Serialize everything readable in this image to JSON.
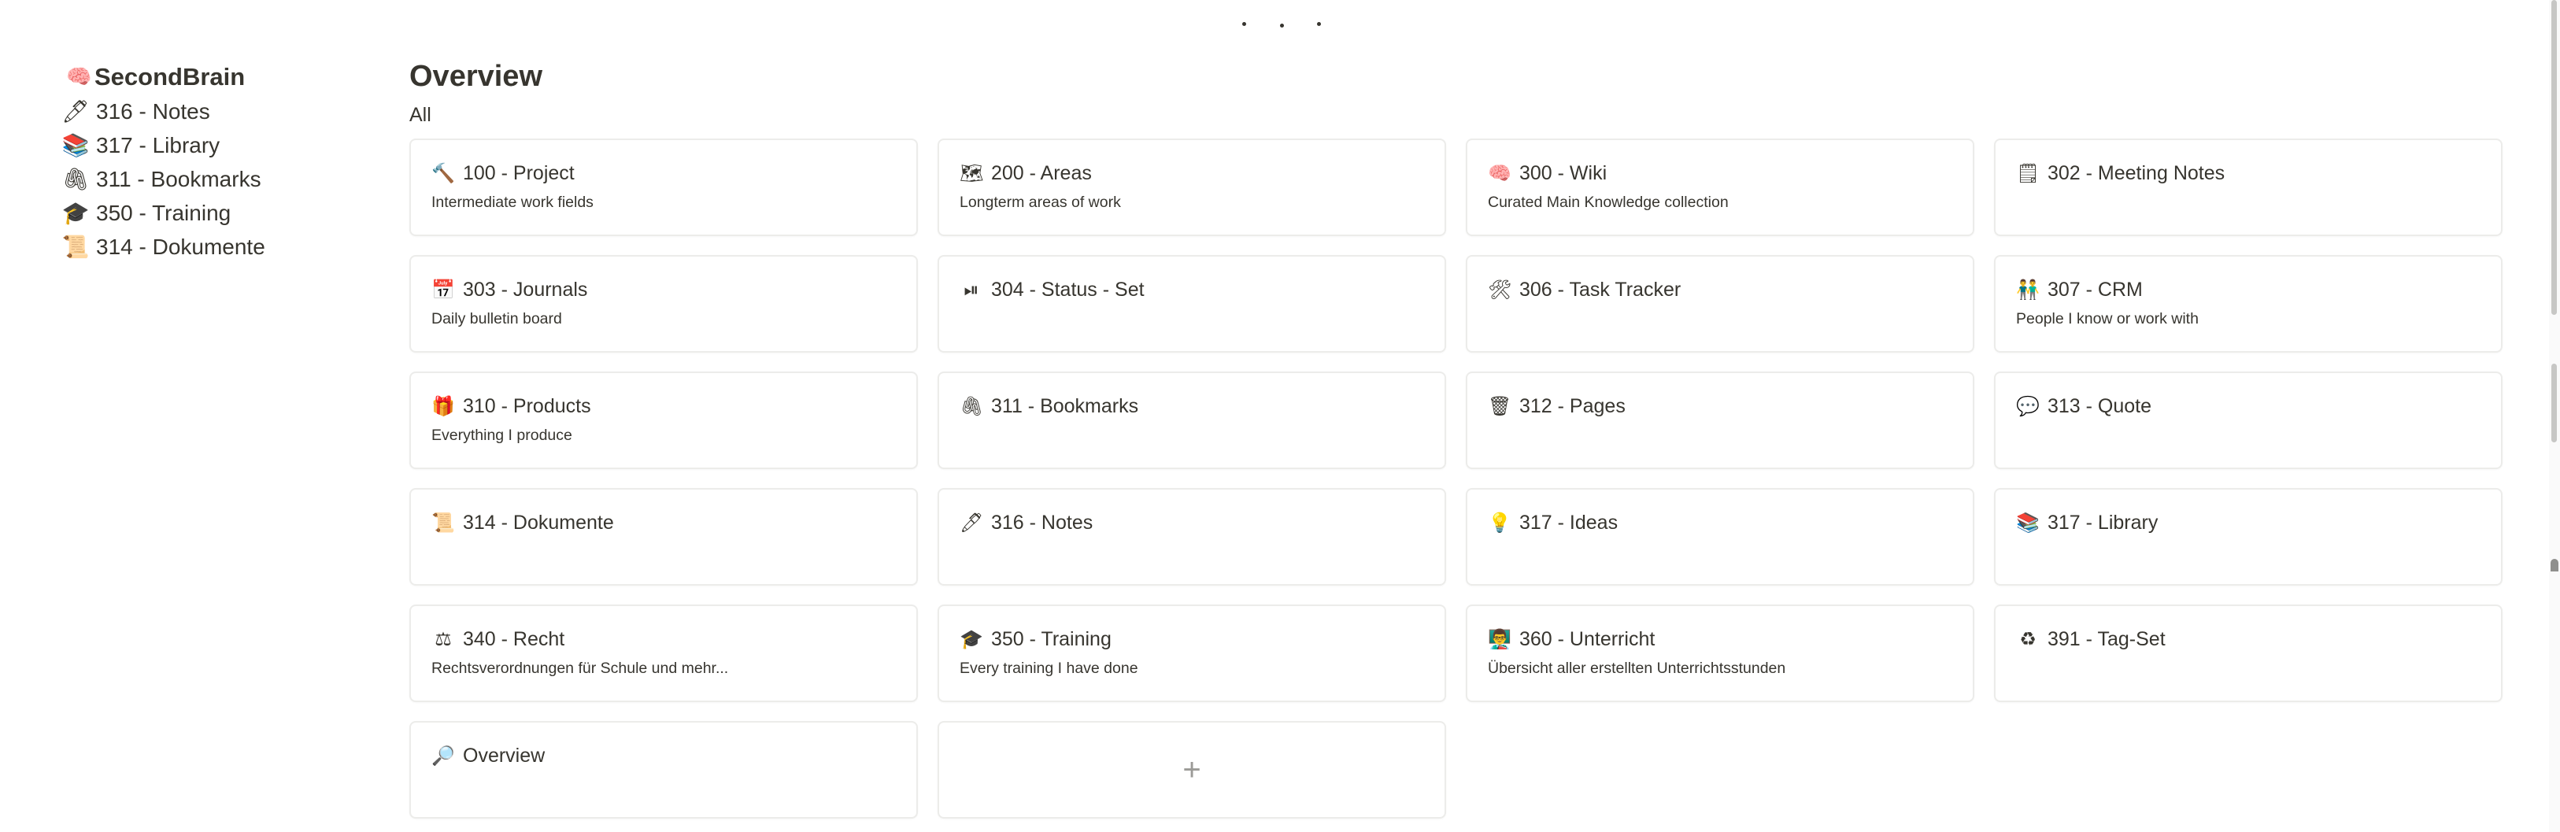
{
  "sidebar": {
    "title": "SecondBrain",
    "title_icon": "brain-icon",
    "title_glyph": "🧠",
    "items": [
      {
        "label": "316 - Notes",
        "icon": "pen-icon",
        "glyph": "🖊"
      },
      {
        "label": "317 - Library",
        "icon": "books-icon",
        "glyph": "📚"
      },
      {
        "label": "311 - Bookmarks",
        "icon": "paperclip-icon",
        "glyph": "🖇"
      },
      {
        "label": "350 - Training",
        "icon": "graduation-cap-icon",
        "glyph": "🎓"
      },
      {
        "label": "314 - Dokumente",
        "icon": "scroll-icon",
        "glyph": "📜"
      }
    ]
  },
  "main": {
    "title": "Overview",
    "filter": "All",
    "add_label": "+",
    "cards": [
      {
        "title": "100 - Project",
        "subtitle": "Intermediate work fields",
        "icon": "hammer-icon",
        "glyph": "🔨"
      },
      {
        "title": "200 - Areas",
        "subtitle": "Longterm areas of work",
        "icon": "map-icon",
        "glyph": "🗺"
      },
      {
        "title": "300 - Wiki",
        "subtitle": "Curated Main Knowledge collection",
        "icon": "brain-icon",
        "glyph": "🧠"
      },
      {
        "title": "302 - Meeting Notes",
        "subtitle": "",
        "icon": "notepad-icon",
        "glyph": "🗒"
      },
      {
        "title": "303 - Journals",
        "subtitle": "Daily bulletin board",
        "icon": "calendar-icon",
        "glyph": "📅"
      },
      {
        "title": "304 - Status - Set",
        "subtitle": "",
        "icon": "play-pause-icon",
        "glyph": "⏯"
      },
      {
        "title": "306 - Task Tracker",
        "subtitle": "",
        "icon": "tools-icon",
        "glyph": "🛠"
      },
      {
        "title": "307 - CRM",
        "subtitle": "People I know or work with",
        "icon": "people-icon",
        "glyph": "👬"
      },
      {
        "title": "310 - Products",
        "subtitle": "Everything I produce",
        "icon": "products-icon",
        "glyph": "🎁"
      },
      {
        "title": "311 - Bookmarks",
        "subtitle": "",
        "icon": "paperclip-icon",
        "glyph": "🖇"
      },
      {
        "title": "312 - Pages",
        "subtitle": "",
        "icon": "wastebasket-icon",
        "glyph": "🗑"
      },
      {
        "title": "313 - Quote",
        "subtitle": "",
        "icon": "speech-bubble-icon",
        "glyph": "💬"
      },
      {
        "title": "314 - Dokumente",
        "subtitle": "",
        "icon": "scroll-icon",
        "glyph": "📜"
      },
      {
        "title": "316 - Notes",
        "subtitle": "",
        "icon": "pen-icon",
        "glyph": "🖊"
      },
      {
        "title": "317 - Ideas",
        "subtitle": "",
        "icon": "lightbulb-icon",
        "glyph": "💡"
      },
      {
        "title": "317 - Library",
        "subtitle": "",
        "icon": "books-icon",
        "glyph": "📚"
      },
      {
        "title": "340 - Recht",
        "subtitle": "Rechtsverordnungen für Schule und mehr...",
        "icon": "scales-icon",
        "glyph": "⚖"
      },
      {
        "title": "350 - Training",
        "subtitle": "Every training I have done",
        "icon": "graduation-cap-icon",
        "glyph": "🎓"
      },
      {
        "title": "360 - Unterricht",
        "subtitle": "Übersicht aller erstellten Unterrichtsstunden",
        "icon": "teacher-icon",
        "glyph": "👨‍🏫"
      },
      {
        "title": "391 - Tag-Set",
        "subtitle": "",
        "icon": "recycle-icon",
        "glyph": "♻"
      },
      {
        "title": "Overview",
        "subtitle": "",
        "icon": "magnifier-icon",
        "glyph": "🔎"
      }
    ]
  }
}
